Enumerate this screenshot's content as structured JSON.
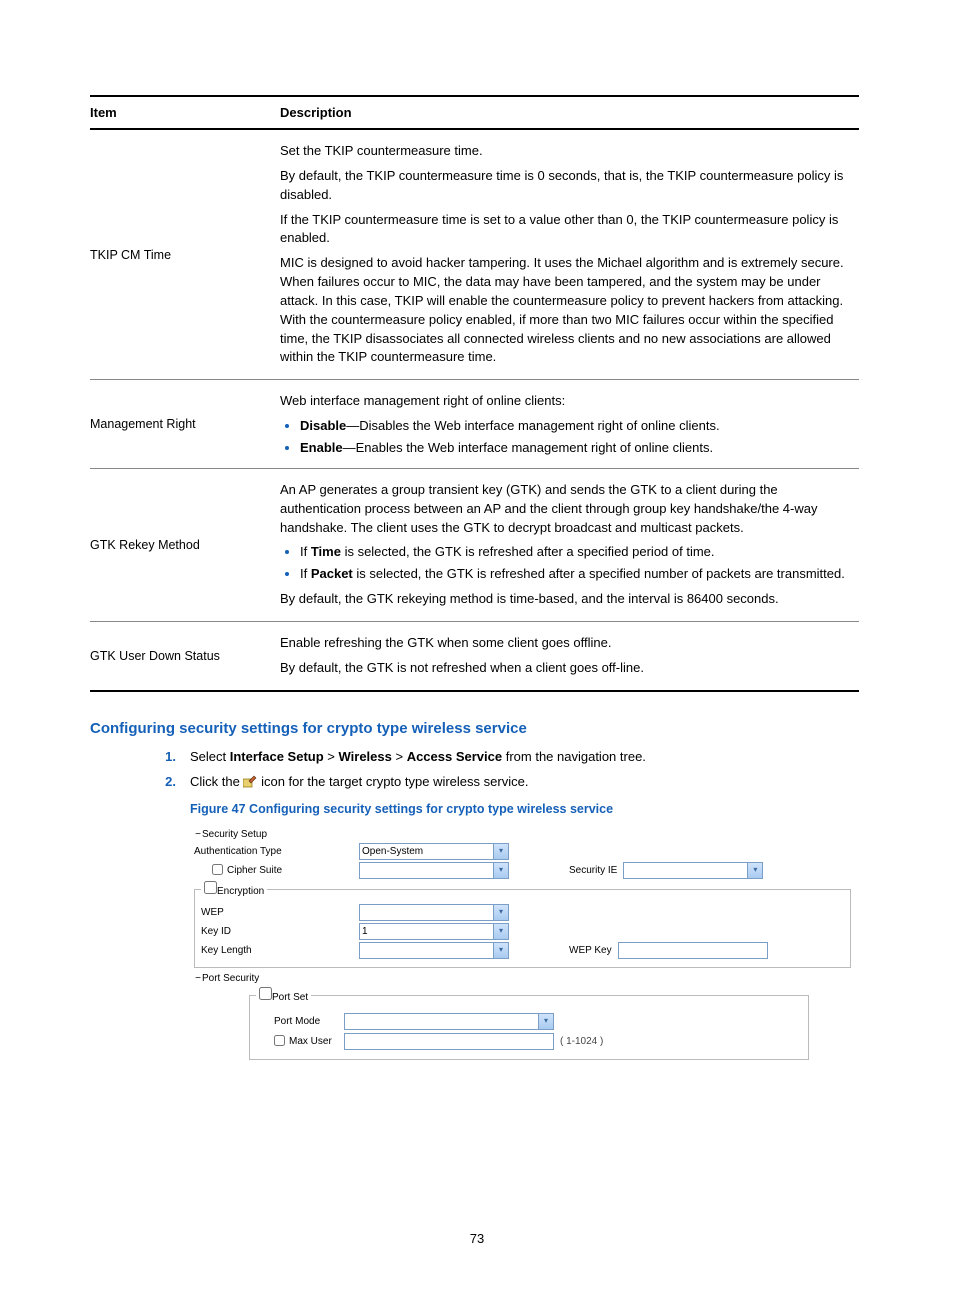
{
  "table": {
    "head": {
      "item": "Item",
      "desc": "Description"
    },
    "rows": [
      {
        "item": "TKIP CM Time",
        "p1": "Set the TKIP countermeasure time.",
        "p2": "By default, the TKIP countermeasure time is 0 seconds, that is, the TKIP countermeasure policy is disabled.",
        "p3": "If the TKIP countermeasure time is set to a value other than 0, the TKIP countermeasure policy is enabled.",
        "p4": "MIC is designed to avoid hacker tampering. It uses the Michael algorithm and is extremely secure. When failures occur to MIC, the data may have been tampered, and the system may be under attack. In this case, TKIP will enable the countermeasure policy to prevent hackers from attacking. With the countermeasure policy enabled, if more than two MIC failures occur within the specified time, the TKIP disassociates all connected wireless clients and no new associations are allowed within the TKIP countermeasure time."
      },
      {
        "item": "Management Right",
        "p1": "Web interface management right of online clients:",
        "li1b": "Disable",
        "li1t": "—Disables the Web interface management right of online clients.",
        "li2b": "Enable",
        "li2t": "—Enables the Web interface management right of online clients."
      },
      {
        "item": "GTK Rekey Method",
        "p1": "An AP generates a group transient key (GTK) and sends the GTK to a client during the authentication process between an AP and the client through group key handshake/the 4-way handshake. The client uses the GTK to decrypt broadcast and multicast packets.",
        "li1a": "If ",
        "li1b": "Time",
        "li1c": " is selected, the GTK is refreshed after a specified period of time.",
        "li2a": "If ",
        "li2b": "Packet",
        "li2c": " is selected, the GTK is refreshed after a specified number of packets are transmitted.",
        "p2": "By default, the GTK rekeying method is time-based, and the interval is 86400 seconds."
      },
      {
        "item": "GTK User Down Status",
        "p1": "Enable refreshing the GTK when some client goes offline.",
        "p2": "By default, the GTK is not refreshed when a client goes off-line."
      }
    ]
  },
  "section_head": "Configuring security settings for crypto type wireless service",
  "steps": {
    "s1a": "Select ",
    "s1b": "Interface Setup",
    "s1c": " > ",
    "s1d": "Wireless",
    "s1e": " > ",
    "s1f": "Access Service",
    "s1g": " from the navigation tree.",
    "s2a": "Click the ",
    "s2b": " icon for the target crypto type wireless service."
  },
  "figcap": "Figure 47 Configuring security settings for crypto type wireless service",
  "form": {
    "sec_setup": "Security Setup",
    "auth_type": "Authentication Type",
    "auth_type_val": "Open-System",
    "cipher_suite": "Cipher Suite",
    "security_ie": "Security IE",
    "encryption": "Encryption",
    "wep": "WEP",
    "key_id": "Key ID",
    "key_id_val": "1",
    "key_length": "Key Length",
    "wep_key": "WEP Key",
    "port_security": "Port Security",
    "port_set": "Port Set",
    "port_mode": "Port Mode",
    "max_user": "Max User",
    "max_user_hint": "( 1-1024 )"
  },
  "page_num": "73"
}
